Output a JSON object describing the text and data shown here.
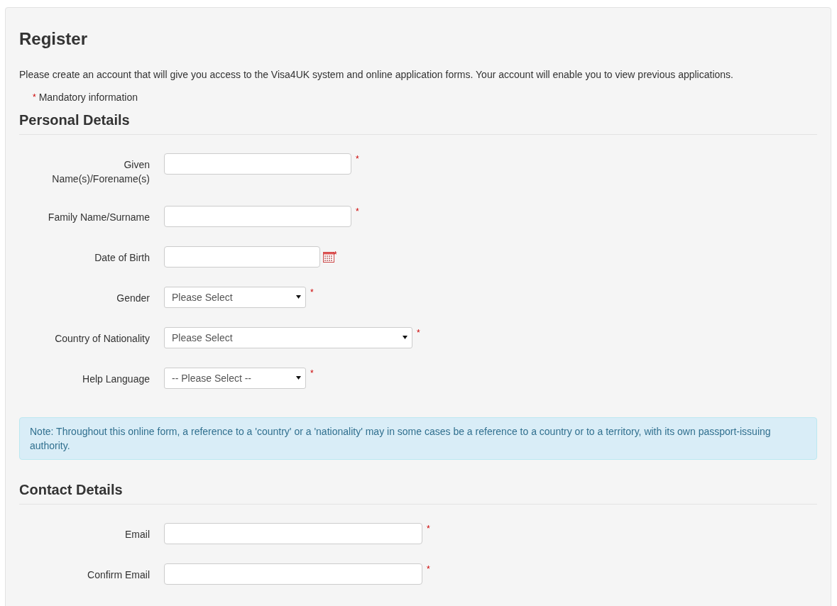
{
  "title": "Register",
  "intro": "Please create an account that will give you access to the Visa4UK system and online application forms. Your account will enable you to view previous applications.",
  "mandatory_note": {
    "mark": "*",
    "text": "Mandatory information"
  },
  "sections": [
    {
      "heading": "Personal Details",
      "fields": [
        {
          "kind": "text",
          "label": "Given Name(s)/Forename(s)",
          "mark": "*"
        },
        {
          "kind": "text",
          "label": "Family Name/Surname",
          "mark": "*"
        },
        {
          "kind": "date",
          "label": "Date of Birth",
          "mark": "*"
        },
        {
          "kind": "select",
          "label": "Gender",
          "value": "Please Select",
          "mark": "*"
        },
        {
          "kind": "select-wide",
          "label": "Country of Nationality",
          "value": "Please Select",
          "mark": "*"
        },
        {
          "kind": "select",
          "label": "Help Language",
          "value": "-- Please Select --",
          "mark": "*"
        }
      ],
      "note": "Note: Throughout this online form, a reference to a 'country' or a 'nationality' may in some cases be a reference to a country or to a territory, with its own passport-issuing authority."
    },
    {
      "heading": "Contact Details",
      "fields": [
        {
          "kind": "email",
          "label": "Email",
          "mark": "*"
        },
        {
          "kind": "email",
          "label": "Confirm Email",
          "mark": "*"
        }
      ]
    }
  ]
}
